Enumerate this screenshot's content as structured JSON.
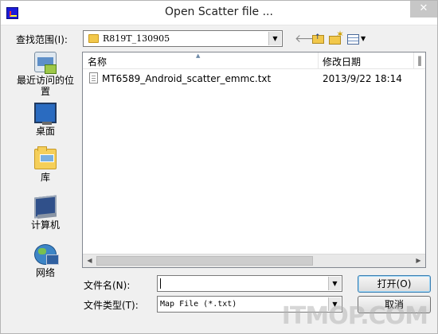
{
  "window": {
    "title": "Open Scatter file ...",
    "close_label": "✕"
  },
  "toolbar": {
    "look_in_label": "查找范围(I):",
    "look_in_value": "R819T_130905",
    "back_icon": "back-arrow-icon",
    "up_icon": "up-folder-icon",
    "new_folder_icon": "new-folder-icon",
    "view_icon": "view-menu-icon"
  },
  "places": [
    {
      "label": "最近访问的位置",
      "icon": "recent-places-icon"
    },
    {
      "label": "桌面",
      "icon": "desktop-icon"
    },
    {
      "label": "库",
      "icon": "library-icon"
    },
    {
      "label": "计算机",
      "icon": "computer-icon"
    },
    {
      "label": "网络",
      "icon": "network-icon"
    }
  ],
  "file_list": {
    "columns": {
      "name": "名称",
      "date": "修改日期",
      "extra": "‖"
    },
    "rows": [
      {
        "name": "MT6589_Android_scatter_emmc.txt",
        "modified": "2013/9/22 18:14"
      }
    ]
  },
  "form": {
    "file_name_label": "文件名(N):",
    "file_name_value": "",
    "file_type_label": "文件类型(T):",
    "file_type_value": "Map File (*.txt)",
    "open_label": "打开(O)",
    "cancel_label": "取消"
  },
  "watermark": {
    "text": "ITMOP.COM"
  },
  "colors": {
    "accent": "#3c7fb1",
    "close_bg": "#c7c7c7"
  }
}
